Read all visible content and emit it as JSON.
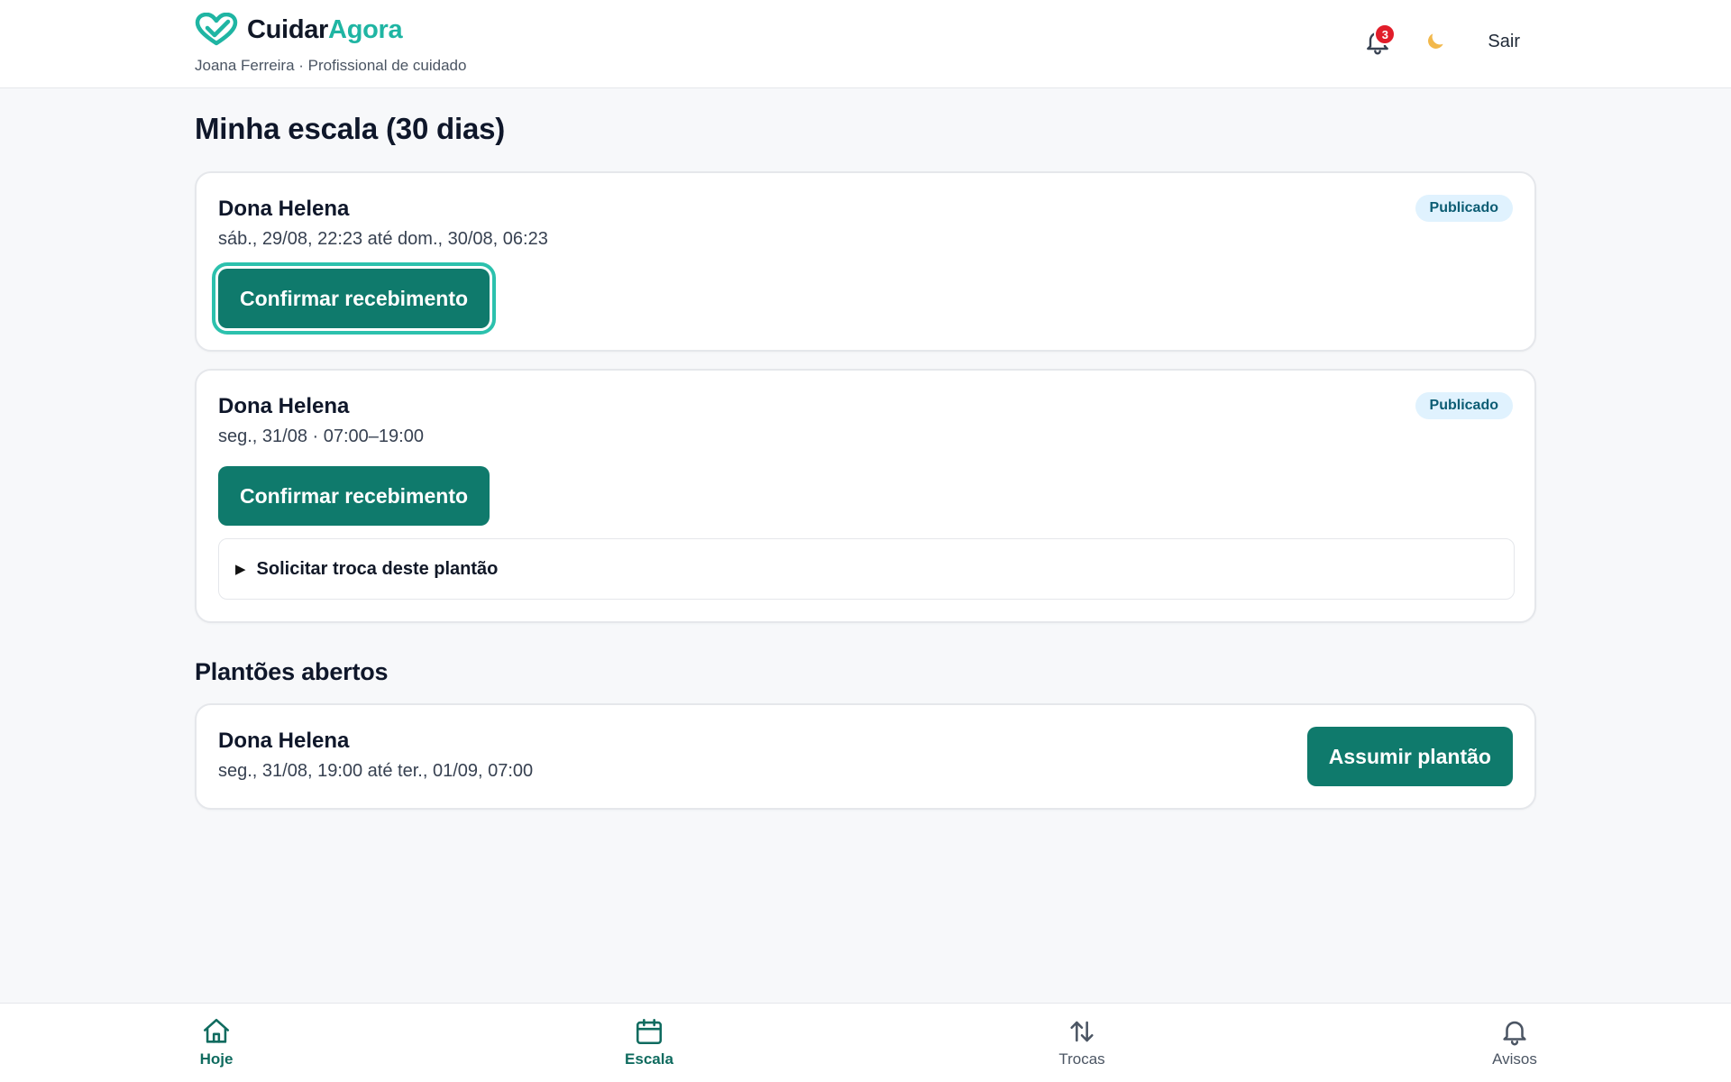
{
  "app": {
    "name_primary": "Cuidar",
    "name_accent": "Agora",
    "user_line": "Joana Ferreira · Profissional de cuidado"
  },
  "header": {
    "notification_count": "3",
    "logout_label": "Sair",
    "icons": [
      "bell-icon",
      "moon-icon"
    ]
  },
  "schedule": {
    "title": "Minha escala (30 dias)",
    "shifts": [
      {
        "name": "Dona Helena",
        "time": "sáb., 29/08, 22:23 até dom., 30/08, 06:23",
        "status": "Publicado",
        "action": "Confirmar recebimento"
      },
      {
        "name": "Dona Helena",
        "time": "seg., 31/08 · 07:00–19:00",
        "status": "Publicado",
        "action": "Confirmar recebimento",
        "swap_label": "Solicitar troca deste plantão"
      }
    ]
  },
  "open_shifts": {
    "title": "Plantões abertos",
    "items": [
      {
        "name": "Dona Helena",
        "time": "seg., 31/08, 19:00 até ter., 01/09, 07:00",
        "action": "Assumir plantão"
      }
    ]
  },
  "nav": {
    "items": [
      {
        "label": "Hoje",
        "icon": "home-icon"
      },
      {
        "label": "Escala",
        "icon": "calendar-icon",
        "active": true
      },
      {
        "label": "Trocas",
        "icon": "swap-arrows-icon"
      },
      {
        "label": "Avisos",
        "icon": "bell-icon"
      }
    ]
  },
  "colors": {
    "accent": "#1fb5a3",
    "button": "#0f7a6c",
    "nav_active": "#0f6b5f",
    "pill_bg": "#e0f2fe",
    "badge": "#e11d2a"
  }
}
